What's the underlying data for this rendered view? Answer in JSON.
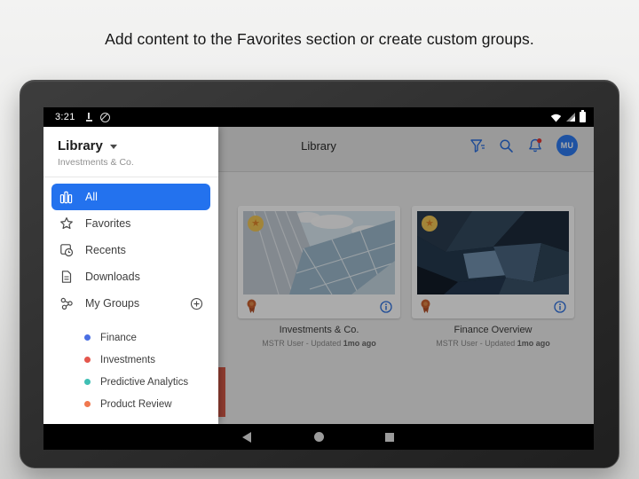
{
  "caption": "Add content to the Favorites section or create custom groups.",
  "status_bar": {
    "time": "3:21",
    "left_icons": [
      "dock-icon",
      "no-signal-icon"
    ],
    "right_icons": [
      "wifi-icon",
      "cell-signal-icon",
      "battery-icon"
    ]
  },
  "app_header": {
    "title": "Library",
    "icons": [
      "filter-icon",
      "search-icon",
      "notifications-icon"
    ],
    "avatar_initials": "MU"
  },
  "sidebar": {
    "title": "Library",
    "subtitle": "Investments & Co.",
    "items": [
      {
        "label": "All",
        "icon": "library-icon",
        "selected": true
      },
      {
        "label": "Favorites",
        "icon": "star-icon",
        "selected": false
      },
      {
        "label": "Recents",
        "icon": "recents-icon",
        "selected": false
      },
      {
        "label": "Downloads",
        "icon": "document-icon",
        "selected": false
      },
      {
        "label": "My Groups",
        "icon": "groups-icon",
        "trailing_icon": "add-circle-icon",
        "selected": false
      }
    ],
    "groups": [
      {
        "label": "Finance",
        "color": "#4a6fe3"
      },
      {
        "label": "Investments",
        "color": "#e4564c"
      },
      {
        "label": "Predictive Analytics",
        "color": "#3fbfb4"
      },
      {
        "label": "Product Review",
        "color": "#f0784f"
      }
    ]
  },
  "cards": [
    {
      "title": "Investments & Co.",
      "meta": "MSTR User - Updated ",
      "meta_bold": "1mo ago",
      "badges": [
        "starred",
        "certified"
      ],
      "star_glyph": "★"
    },
    {
      "title": "Finance Overview",
      "meta": "MSTR User - Updated ",
      "meta_bold": "1mo ago",
      "badges": [
        "starred",
        "certified"
      ],
      "star_glyph": "★"
    }
  ],
  "nav_bar": {
    "icons": [
      "back-icon",
      "home-icon",
      "recent-apps-icon"
    ]
  },
  "colors": {
    "accent_blue": "#2372ee",
    "badge_amber": "#f2c755",
    "certified_orange": "#c75b2e",
    "notification_red": "#e53935"
  }
}
